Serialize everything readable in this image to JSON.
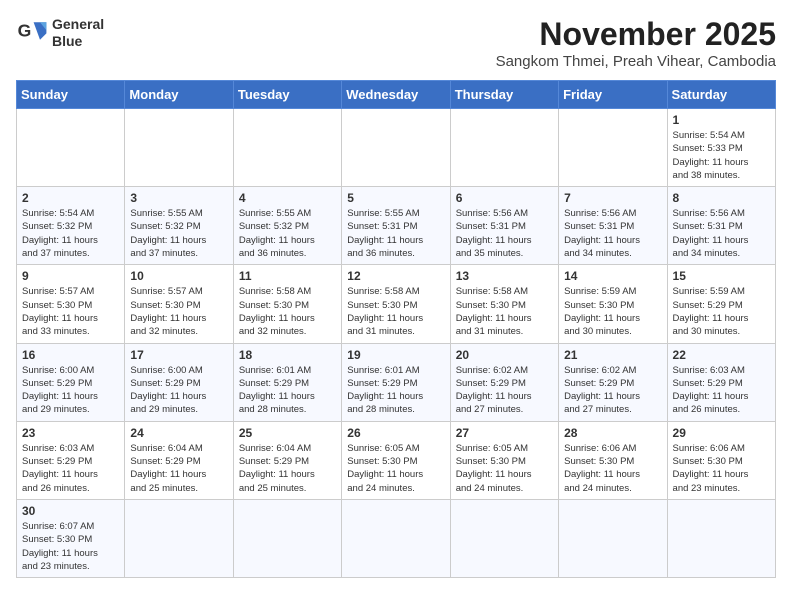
{
  "header": {
    "logo_line1": "General",
    "logo_line2": "Blue",
    "month": "November 2025",
    "location": "Sangkom Thmei, Preah Vihear, Cambodia"
  },
  "weekdays": [
    "Sunday",
    "Monday",
    "Tuesday",
    "Wednesday",
    "Thursday",
    "Friday",
    "Saturday"
  ],
  "weeks": [
    [
      {
        "day": "",
        "info": ""
      },
      {
        "day": "",
        "info": ""
      },
      {
        "day": "",
        "info": ""
      },
      {
        "day": "",
        "info": ""
      },
      {
        "day": "",
        "info": ""
      },
      {
        "day": "",
        "info": ""
      },
      {
        "day": "1",
        "info": "Sunrise: 5:54 AM\nSunset: 5:33 PM\nDaylight: 11 hours\nand 38 minutes."
      }
    ],
    [
      {
        "day": "2",
        "info": "Sunrise: 5:54 AM\nSunset: 5:32 PM\nDaylight: 11 hours\nand 37 minutes."
      },
      {
        "day": "3",
        "info": "Sunrise: 5:55 AM\nSunset: 5:32 PM\nDaylight: 11 hours\nand 37 minutes."
      },
      {
        "day": "4",
        "info": "Sunrise: 5:55 AM\nSunset: 5:32 PM\nDaylight: 11 hours\nand 36 minutes."
      },
      {
        "day": "5",
        "info": "Sunrise: 5:55 AM\nSunset: 5:31 PM\nDaylight: 11 hours\nand 36 minutes."
      },
      {
        "day": "6",
        "info": "Sunrise: 5:56 AM\nSunset: 5:31 PM\nDaylight: 11 hours\nand 35 minutes."
      },
      {
        "day": "7",
        "info": "Sunrise: 5:56 AM\nSunset: 5:31 PM\nDaylight: 11 hours\nand 34 minutes."
      },
      {
        "day": "8",
        "info": "Sunrise: 5:56 AM\nSunset: 5:31 PM\nDaylight: 11 hours\nand 34 minutes."
      }
    ],
    [
      {
        "day": "9",
        "info": "Sunrise: 5:57 AM\nSunset: 5:30 PM\nDaylight: 11 hours\nand 33 minutes."
      },
      {
        "day": "10",
        "info": "Sunrise: 5:57 AM\nSunset: 5:30 PM\nDaylight: 11 hours\nand 32 minutes."
      },
      {
        "day": "11",
        "info": "Sunrise: 5:58 AM\nSunset: 5:30 PM\nDaylight: 11 hours\nand 32 minutes."
      },
      {
        "day": "12",
        "info": "Sunrise: 5:58 AM\nSunset: 5:30 PM\nDaylight: 11 hours\nand 31 minutes."
      },
      {
        "day": "13",
        "info": "Sunrise: 5:58 AM\nSunset: 5:30 PM\nDaylight: 11 hours\nand 31 minutes."
      },
      {
        "day": "14",
        "info": "Sunrise: 5:59 AM\nSunset: 5:30 PM\nDaylight: 11 hours\nand 30 minutes."
      },
      {
        "day": "15",
        "info": "Sunrise: 5:59 AM\nSunset: 5:29 PM\nDaylight: 11 hours\nand 30 minutes."
      }
    ],
    [
      {
        "day": "16",
        "info": "Sunrise: 6:00 AM\nSunset: 5:29 PM\nDaylight: 11 hours\nand 29 minutes."
      },
      {
        "day": "17",
        "info": "Sunrise: 6:00 AM\nSunset: 5:29 PM\nDaylight: 11 hours\nand 29 minutes."
      },
      {
        "day": "18",
        "info": "Sunrise: 6:01 AM\nSunset: 5:29 PM\nDaylight: 11 hours\nand 28 minutes."
      },
      {
        "day": "19",
        "info": "Sunrise: 6:01 AM\nSunset: 5:29 PM\nDaylight: 11 hours\nand 28 minutes."
      },
      {
        "day": "20",
        "info": "Sunrise: 6:02 AM\nSunset: 5:29 PM\nDaylight: 11 hours\nand 27 minutes."
      },
      {
        "day": "21",
        "info": "Sunrise: 6:02 AM\nSunset: 5:29 PM\nDaylight: 11 hours\nand 27 minutes."
      },
      {
        "day": "22",
        "info": "Sunrise: 6:03 AM\nSunset: 5:29 PM\nDaylight: 11 hours\nand 26 minutes."
      }
    ],
    [
      {
        "day": "23",
        "info": "Sunrise: 6:03 AM\nSunset: 5:29 PM\nDaylight: 11 hours\nand 26 minutes."
      },
      {
        "day": "24",
        "info": "Sunrise: 6:04 AM\nSunset: 5:29 PM\nDaylight: 11 hours\nand 25 minutes."
      },
      {
        "day": "25",
        "info": "Sunrise: 6:04 AM\nSunset: 5:29 PM\nDaylight: 11 hours\nand 25 minutes."
      },
      {
        "day": "26",
        "info": "Sunrise: 6:05 AM\nSunset: 5:30 PM\nDaylight: 11 hours\nand 24 minutes."
      },
      {
        "day": "27",
        "info": "Sunrise: 6:05 AM\nSunset: 5:30 PM\nDaylight: 11 hours\nand 24 minutes."
      },
      {
        "day": "28",
        "info": "Sunrise: 6:06 AM\nSunset: 5:30 PM\nDaylight: 11 hours\nand 24 minutes."
      },
      {
        "day": "29",
        "info": "Sunrise: 6:06 AM\nSunset: 5:30 PM\nDaylight: 11 hours\nand 23 minutes."
      }
    ],
    [
      {
        "day": "30",
        "info": "Sunrise: 6:07 AM\nSunset: 5:30 PM\nDaylight: 11 hours\nand 23 minutes."
      },
      {
        "day": "",
        "info": ""
      },
      {
        "day": "",
        "info": ""
      },
      {
        "day": "",
        "info": ""
      },
      {
        "day": "",
        "info": ""
      },
      {
        "day": "",
        "info": ""
      },
      {
        "day": "",
        "info": ""
      }
    ]
  ]
}
